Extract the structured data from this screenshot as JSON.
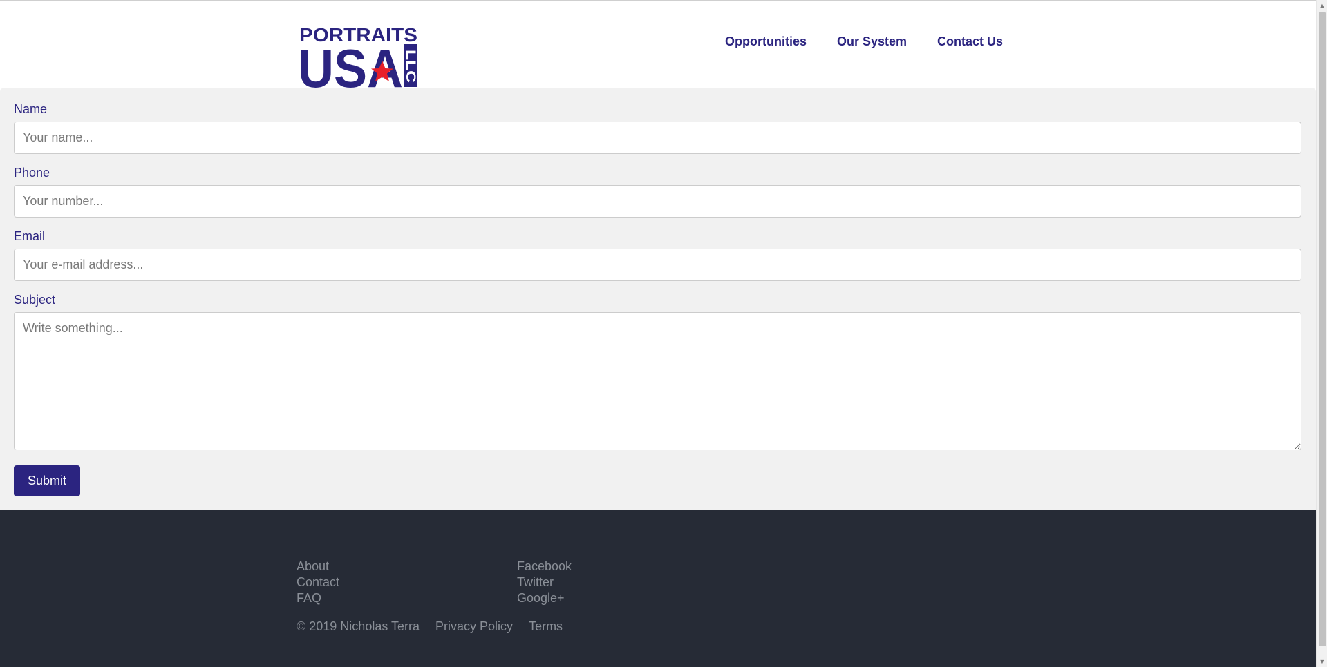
{
  "header": {
    "logo": {
      "line1": "PORTRAITS",
      "line2": "USA",
      "suffix": "LLC",
      "colors": {
        "blue": "#2b2480",
        "red": "#e8202a",
        "white": "#ffffff"
      }
    },
    "nav": [
      {
        "label": "Opportunities"
      },
      {
        "label": "Our System"
      },
      {
        "label": "Contact Us"
      }
    ]
  },
  "form": {
    "name": {
      "label": "Name",
      "placeholder": "Your name...",
      "value": ""
    },
    "phone": {
      "label": "Phone",
      "placeholder": "Your number...",
      "value": ""
    },
    "email": {
      "label": "Email",
      "placeholder": "Your e-mail address...",
      "value": ""
    },
    "subject": {
      "label": "Subject",
      "placeholder": "Write something...",
      "value": ""
    },
    "submit_label": "Submit"
  },
  "footer": {
    "col1": [
      "About",
      "Contact",
      "FAQ"
    ],
    "col2": [
      "Facebook",
      "Twitter",
      "Google+"
    ],
    "copyright": "© 2019 Nicholas Terra",
    "privacy": "Privacy Policy",
    "terms": "Terms"
  },
  "colors": {
    "accent": "#2b2480",
    "footer_bg": "#262b36",
    "form_bg": "#f1f1f1",
    "footer_text": "#8a8f97"
  },
  "icons": {
    "scroll_up": "chevron-up-icon",
    "scroll_down": "chevron-down-icon"
  }
}
